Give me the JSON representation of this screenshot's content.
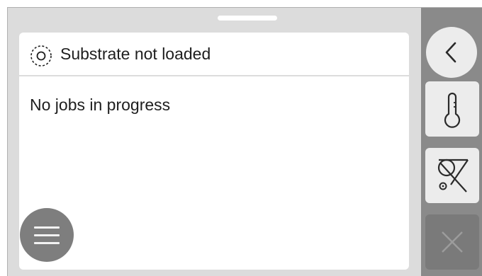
{
  "status": {
    "substrate_text": "Substrate not loaded",
    "substrate_icon": "substrate-roll-icon"
  },
  "jobs": {
    "text": "No jobs in progress"
  },
  "menu_button": {
    "icon": "hamburger-menu-icon"
  },
  "sidebar": {
    "back_icon": "chevron-left-icon",
    "temperature_icon": "thermometer-icon",
    "unload_icon": "substrate-unload-icon",
    "cancel_icon": "close-icon",
    "cancel_enabled": false
  },
  "colors": {
    "panel_background": "#dcdcdc",
    "card_background": "#ffffff",
    "sidebar_background": "#8a8a8a",
    "button_light": "#ececec",
    "button_disabled": "#7a7a7a",
    "menu_button": "#7e7e7e",
    "text": "#1e1e1e"
  }
}
